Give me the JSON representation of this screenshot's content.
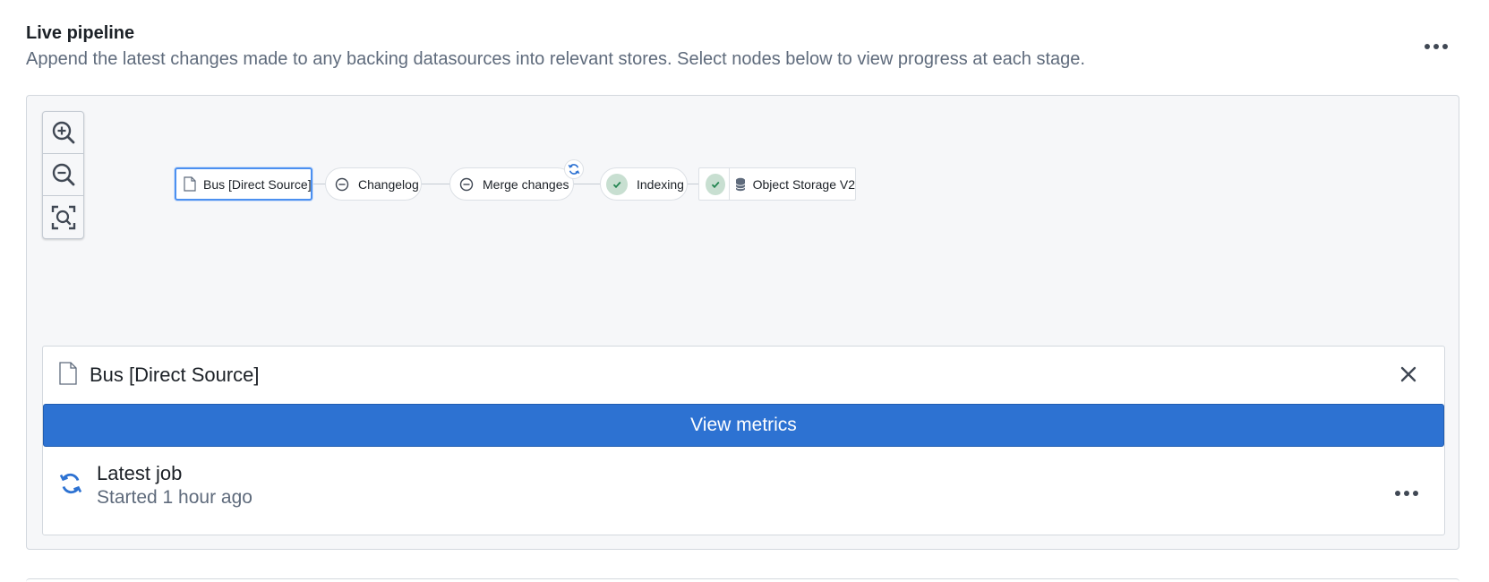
{
  "header": {
    "title": "Live pipeline",
    "subtitle": "Append the latest changes made to any backing datasources into relevant stores. Select nodes below to view progress at each stage.",
    "more_icon": "more-horizontal-icon"
  },
  "zoom": {
    "zoom_in_icon": "zoom-in-icon",
    "zoom_out_icon": "zoom-out-icon",
    "fit_icon": "zoom-to-fit-icon"
  },
  "pipeline": {
    "nodes": [
      {
        "label": "Bus [Direct Source]",
        "icon": "document-icon",
        "state": "selected"
      },
      {
        "label": "Changelog",
        "icon": "minus-circle-icon",
        "state": "idle"
      },
      {
        "label": "Merge changes",
        "icon": "minus-circle-icon",
        "state": "running"
      },
      {
        "label": "Indexing",
        "icon": "check-icon",
        "state": "success"
      },
      {
        "label": "Object Storage V2",
        "icon": "database-icon",
        "state": "success"
      }
    ]
  },
  "detail": {
    "name": "Bus [Direct Source]",
    "icon": "document-icon",
    "view_metrics_label": "View metrics",
    "latest_job": {
      "title": "Latest job",
      "status": "Started 1 hour ago",
      "icon": "refresh-icon"
    }
  },
  "colors": {
    "primary": "#2d72d2",
    "success_bg": "#c8dfd1",
    "success_fg": "#238551",
    "running": "#2d72d2",
    "muted_text": "#5f6b7c"
  }
}
